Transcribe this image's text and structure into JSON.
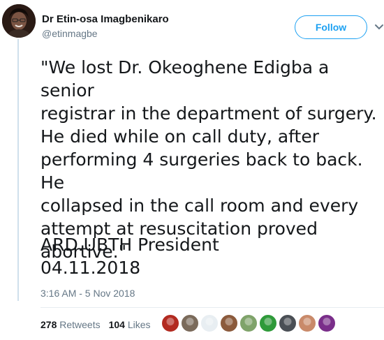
{
  "author": {
    "name": "Dr Etin-osa Imagbenikaro",
    "handle": "@etinmagbe",
    "avatar_icon": "profile-photo-avatar"
  },
  "follow_label": "Follow",
  "tweet": {
    "text": "\"We lost Dr. Okeoghene Edigba a senior\nregistrar in the department of surgery.\nHe died while on call duty, after\nperforming 4 surgeries back to back. He\ncollapsed in the call room and every\nattempt at resuscitation proved\nabortive.\"",
    "signoff_line1": "ARD.UBTH President",
    "signoff_line2": "04.11.2018",
    "timestamp": "3:16 AM - 5 Nov 2018"
  },
  "stats": {
    "retweets_count": "278",
    "retweets_label": "Retweets",
    "likes_count": "104",
    "likes_label": "Likes"
  },
  "likers": [
    {
      "name": "liker-avatar-1",
      "color": "#b22a20"
    },
    {
      "name": "liker-avatar-2",
      "color": "#7a6a5a"
    },
    {
      "name": "liker-avatar-3",
      "color": "#e8eef2"
    },
    {
      "name": "liker-avatar-4",
      "color": "#8b5a3c"
    },
    {
      "name": "liker-avatar-5",
      "color": "#7fa36a"
    },
    {
      "name": "liker-avatar-6",
      "color": "#2f9a3a"
    },
    {
      "name": "liker-avatar-7",
      "color": "#4a4f55"
    },
    {
      "name": "liker-avatar-8",
      "color": "#c98a6a"
    },
    {
      "name": "liker-avatar-9",
      "color": "#7a2e8a"
    }
  ],
  "colors": {
    "accent": "#1da1f2",
    "text": "#14171a",
    "secondary": "#657786"
  }
}
